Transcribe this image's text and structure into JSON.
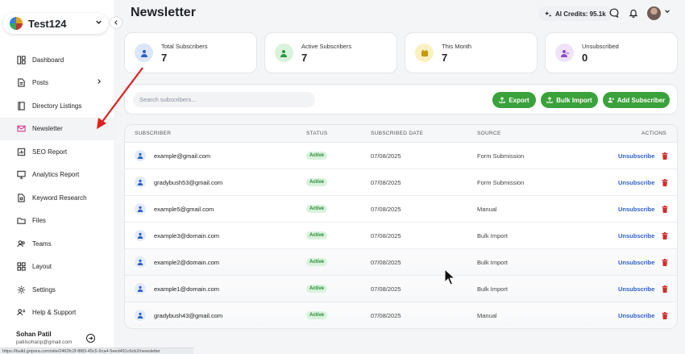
{
  "workspace": {
    "name": "Test124"
  },
  "sidebar": {
    "items": [
      {
        "label": "Dashboard",
        "icon": "dashboard-icon"
      },
      {
        "label": "Posts",
        "icon": "document-icon",
        "has_arrow": true
      },
      {
        "label": "Directory Listings",
        "icon": "book-icon"
      },
      {
        "label": "Newsletter",
        "icon": "mail-icon",
        "active": true
      },
      {
        "label": "SEO Report",
        "icon": "report-icon"
      },
      {
        "label": "Analytics Report",
        "icon": "monitor-icon"
      },
      {
        "label": "Keyword Research",
        "icon": "search-doc-icon"
      },
      {
        "label": "Files",
        "icon": "folder-icon"
      },
      {
        "label": "Teams",
        "icon": "users-icon"
      },
      {
        "label": "Layout",
        "icon": "grid-icon"
      },
      {
        "label": "Settings",
        "icon": "gear-icon"
      },
      {
        "label": "Help & Support",
        "icon": "help-icon"
      }
    ],
    "user": {
      "name": "Sohan Patil",
      "email": "patilsohanp@gmail.com"
    }
  },
  "statusbar": {
    "url": "https://build.gripora.com/site/2462fc2f-f883-45c5-9ca4-5eed491c6cb2/newsletter"
  },
  "header": {
    "title": "Newsletter",
    "credits": "AI Credits: 95.1k"
  },
  "stats": [
    {
      "label": "Total Subscribers",
      "value": "7",
      "color": "#dbe6fb",
      "icon_color": "#2c5fc9",
      "icon": "user-icon"
    },
    {
      "label": "Active Subscribers",
      "value": "7",
      "color": "#d9f2dc",
      "icon_color": "#2c9a42",
      "icon": "user-check-icon"
    },
    {
      "label": "This Month",
      "value": "7",
      "color": "#fbf0c2",
      "icon_color": "#c79a0a",
      "icon": "calendar-icon"
    },
    {
      "label": "Unsubscribed",
      "value": "0",
      "color": "#efe3fb",
      "icon_color": "#8d4cc8",
      "icon": "user-minus-icon"
    }
  ],
  "toolbar": {
    "search_placeholder": "Search subscribers...",
    "export_label": "Export",
    "bulk_import_label": "Bulk Import",
    "add_label": "Add Subscriber"
  },
  "table": {
    "headers": [
      "SUBSCRIBER",
      "STATUS",
      "SUBSCRIBED DATE",
      "SOURCE",
      "ACTIONS"
    ],
    "rows": [
      {
        "email": "example@gmail.com",
        "status": "Active",
        "date": "07/08/2025",
        "source": "Form Submission",
        "action": "Unsubscribe"
      },
      {
        "email": "gradybush53@gmail.com",
        "status": "Active",
        "date": "07/08/2025",
        "source": "Form Submission",
        "action": "Unsubscribe"
      },
      {
        "email": "example5@gmail.com",
        "status": "Active",
        "date": "07/08/2025",
        "source": "Manual",
        "action": "Unsubscribe"
      },
      {
        "email": "example3@domain.com",
        "status": "Active",
        "date": "07/08/2025",
        "source": "Bulk Import",
        "action": "Unsubscribe"
      },
      {
        "email": "example2@domain.com",
        "status": "Active",
        "date": "07/08/2025",
        "source": "Bulk Import",
        "action": "Unsubscribe"
      },
      {
        "email": "example1@domain.com",
        "status": "Active",
        "date": "07/08/2025",
        "source": "Bulk Import",
        "action": "Unsubscribe"
      },
      {
        "email": "gradybush43@gmail.com",
        "status": "Active",
        "date": "07/08/2025",
        "source": "Manual",
        "action": "Unsubscribe"
      }
    ]
  },
  "colors": {
    "accent_green": "#3aa23a",
    "link_blue": "#2c5fc9",
    "delete_red": "#d62b2b",
    "annotation_red": "#e02020"
  }
}
